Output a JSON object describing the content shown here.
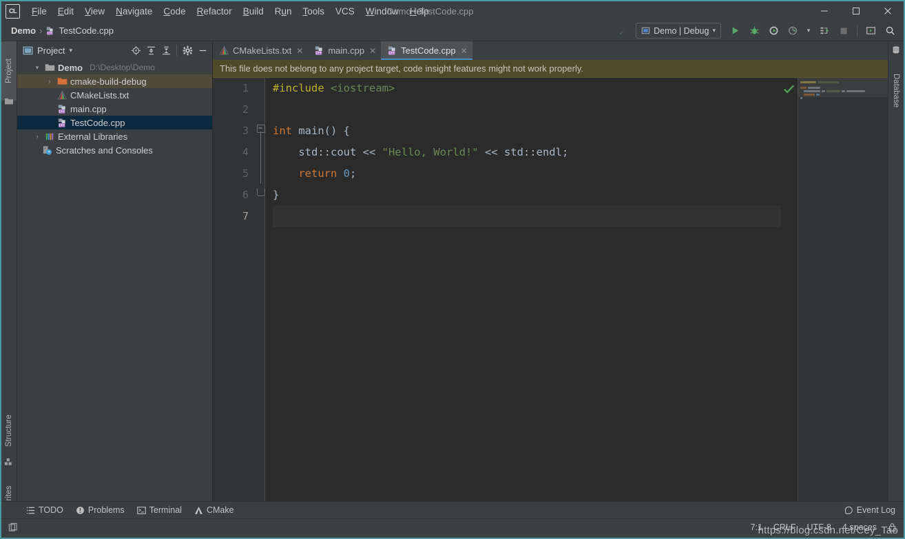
{
  "window": {
    "title": "Demo - TestCode.cpp",
    "logo_text": "CL",
    "minimize": "─",
    "maximize": "☐",
    "close": "✕"
  },
  "menubar": {
    "items": [
      {
        "label": "File",
        "mnemonic": "F"
      },
      {
        "label": "Edit",
        "mnemonic": "E"
      },
      {
        "label": "View",
        "mnemonic": "V"
      },
      {
        "label": "Navigate",
        "mnemonic": "N"
      },
      {
        "label": "Code",
        "mnemonic": "C"
      },
      {
        "label": "Refactor",
        "mnemonic": "R"
      },
      {
        "label": "Build",
        "mnemonic": "B"
      },
      {
        "label": "Run",
        "mnemonic": "u"
      },
      {
        "label": "Tools",
        "mnemonic": "T"
      },
      {
        "label": "VCS",
        "mnemonic": ""
      },
      {
        "label": "Window",
        "mnemonic": "W"
      },
      {
        "label": "Help",
        "mnemonic": "H"
      }
    ]
  },
  "breadcrumb": {
    "project": "Demo",
    "separator": "›",
    "file": "TestCode.cpp"
  },
  "toolbar": {
    "build_hammer": "build-icon",
    "run_config": "Demo | Debug",
    "run_config_caret": "▾",
    "run": "run-icon",
    "debug": "debug-icon",
    "run_with_coverage": "run-coverage-icon",
    "profile": "profile-icon",
    "profile_caret": "▾",
    "attach": "attach-to-process-icon",
    "stop": "stop-icon",
    "toggle_terminal": "terminal-toggle-icon",
    "search_everywhere": "search-icon"
  },
  "left_strip": {
    "project_label": "Project",
    "structure_label": "Structure",
    "favorites_label": "Favorites"
  },
  "right_strip": {
    "database_label": "Database"
  },
  "project_panel": {
    "title": "Project",
    "caret": "▾",
    "actions": [
      "locate-icon",
      "expand-all-icon",
      "collapse-all-icon",
      "settings-gear-icon",
      "hide-panel-icon"
    ],
    "tree": [
      {
        "id": "demo",
        "label": "Demo",
        "path": "D:\\Desktop\\Demo",
        "icon": "folder-module-icon",
        "arrow": "⌄",
        "depth": 0,
        "state": "expanded",
        "selection": "none"
      },
      {
        "id": "cmake-build-debug",
        "label": "cmake-build-debug",
        "path": "",
        "icon": "folder-excluded-icon",
        "arrow": "›",
        "depth": 1,
        "state": "collapsed",
        "selection": "inactive"
      },
      {
        "id": "cmakelists",
        "label": "CMakeLists.txt",
        "path": "",
        "icon": "cmake-icon",
        "arrow": "",
        "depth": 2,
        "state": "leaf",
        "selection": "none"
      },
      {
        "id": "main-cpp",
        "label": "main.cpp",
        "path": "",
        "icon": "cpp-file-icon",
        "arrow": "",
        "depth": 2,
        "state": "leaf",
        "selection": "none"
      },
      {
        "id": "testcode-cpp",
        "label": "TestCode.cpp",
        "path": "",
        "icon": "cpp-file-icon",
        "arrow": "",
        "depth": 2,
        "state": "leaf",
        "selection": "active"
      },
      {
        "id": "external-libraries",
        "label": "External Libraries",
        "path": "",
        "icon": "libraries-icon",
        "arrow": "›",
        "depth": 0,
        "state": "collapsed",
        "selection": "none"
      },
      {
        "id": "scratches",
        "label": "Scratches and Consoles",
        "path": "",
        "icon": "scratches-icon",
        "arrow": "",
        "depth": 0,
        "state": "leaf",
        "selection": "none"
      }
    ]
  },
  "editor": {
    "tabs": [
      {
        "label": "CMakeLists.txt",
        "icon": "cmake-icon",
        "active": false,
        "close": "✕"
      },
      {
        "label": "main.cpp",
        "icon": "cpp-file-icon",
        "active": false,
        "close": "✕"
      },
      {
        "label": "TestCode.cpp",
        "icon": "cpp-file-icon",
        "active": true,
        "close": "✕"
      }
    ],
    "notification": "This file does not belong to any project target, code insight features might not work properly.",
    "inspection_status": "ok-check-icon",
    "line_numbers": [
      "1",
      "2",
      "3",
      "4",
      "5",
      "6",
      "7"
    ],
    "current_line": 7,
    "lines": [
      {
        "n": 1,
        "tokens": [
          {
            "t": "#include",
            "c": "dir"
          },
          {
            "t": " ",
            "c": "plain"
          },
          {
            "t": "<iostream>",
            "c": "inc"
          }
        ]
      },
      {
        "n": 2,
        "tokens": []
      },
      {
        "n": 3,
        "tokens": [
          {
            "t": "int",
            "c": "kw"
          },
          {
            "t": " main() {",
            "c": "plain"
          }
        ]
      },
      {
        "n": 4,
        "tokens": [
          {
            "t": "    std",
            "c": "plain"
          },
          {
            "t": "::",
            "c": "plain"
          },
          {
            "t": "cout",
            "c": "plain"
          },
          {
            "t": " << ",
            "c": "plain"
          },
          {
            "t": "\"Hello, World!\"",
            "c": "str"
          },
          {
            "t": " << ",
            "c": "plain"
          },
          {
            "t": "std::endl",
            "c": "plain"
          },
          {
            "t": ";",
            "c": "plain"
          }
        ]
      },
      {
        "n": 5,
        "tokens": [
          {
            "t": "    ",
            "c": "plain"
          },
          {
            "t": "return",
            "c": "kw"
          },
          {
            "t": " ",
            "c": "plain"
          },
          {
            "t": "0",
            "c": "num"
          },
          {
            "t": ";",
            "c": "plain"
          }
        ]
      },
      {
        "n": 6,
        "tokens": [
          {
            "t": "}",
            "c": "plain"
          }
        ]
      },
      {
        "n": 7,
        "tokens": []
      }
    ],
    "code_text": {
      "l1_directive": "#include",
      "l1_header": "<iostream>",
      "l3_kw": "int",
      "l3_rest": " main() {",
      "l4_pre": "    std::cout << ",
      "l4_str": "\"Hello, World!\"",
      "l4_post": " << std::endl;",
      "l5_indent": "    ",
      "l5_kw": "return",
      "l5_space": " ",
      "l5_num": "0",
      "l5_semi": ";",
      "l6": "}"
    }
  },
  "bottom_bar": {
    "items": [
      {
        "label": "TODO",
        "icon": "todo-icon"
      },
      {
        "label": "Problems",
        "icon": "problems-icon"
      },
      {
        "label": "Terminal",
        "icon": "terminal-icon"
      },
      {
        "label": "CMake",
        "icon": "cmake-icon"
      }
    ],
    "event_log": {
      "label": "Event Log",
      "icon": "event-log-icon"
    }
  },
  "status_bar": {
    "caret_position": "7:1",
    "line_separator": "CRLF",
    "encoding": "UTF-8",
    "indent": "4 spaces",
    "lock_icon": "lock-icon",
    "left_icon": "editor-layout-icon"
  },
  "watermark": "https://blog.csdn.net/Cey_Tao",
  "colors": {
    "window_bg": "#3c3f41",
    "editor_bg": "#2b2b2b",
    "gutter_bg": "#313335",
    "accent_border": "#4a9ba5",
    "tab_active_underline": "#4a88c7",
    "notification_bg": "#4f4b28",
    "selection_active": "#0d293e",
    "selection_inactive": "#4e4b3d",
    "keyword": "#cc7832",
    "string": "#6a8759",
    "number": "#6897bb",
    "directive": "#bbb529",
    "identifier": "#a9b7c6",
    "run_green": "#59a869"
  }
}
